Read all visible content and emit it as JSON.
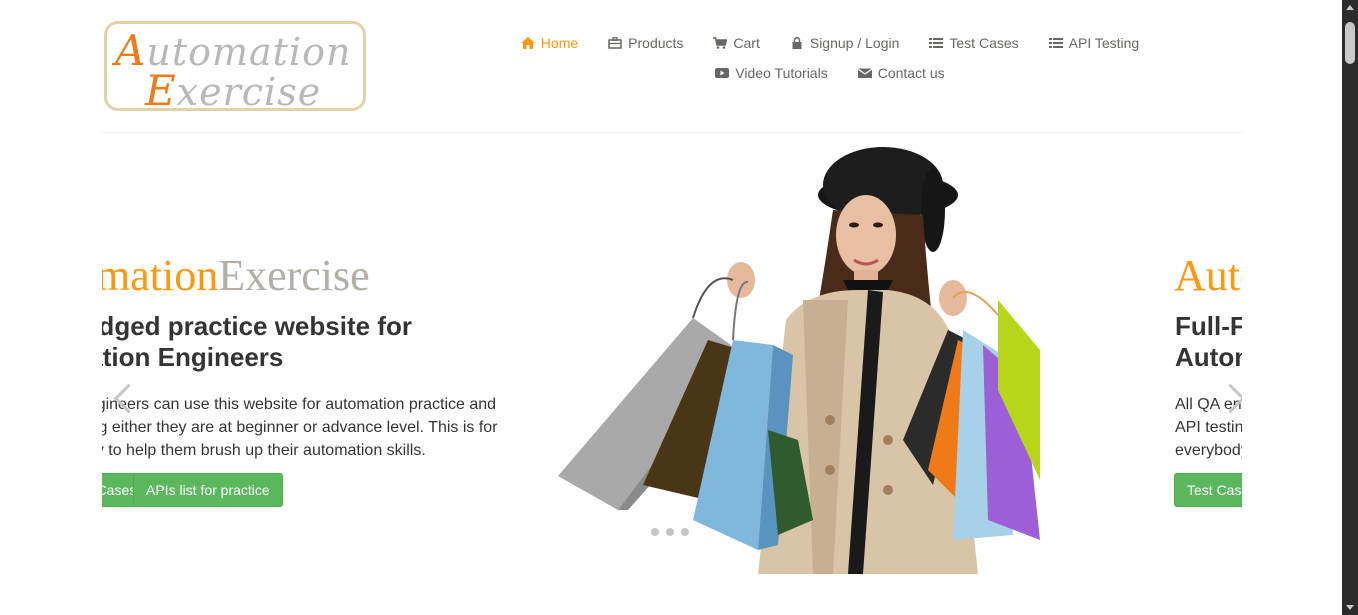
{
  "logo": {
    "line1_cap": "A",
    "line1_rest": "utomation",
    "line2_cap": "E",
    "line2_rest": "xercise",
    "colors": {
      "accent": "#f07a17",
      "text": "#b8b8b8",
      "border": "#e2d3a7"
    }
  },
  "nav": {
    "row1": [
      {
        "label": "Home",
        "icon": "home-icon",
        "active": true
      },
      {
        "label": "Products",
        "icon": "briefcase-icon"
      },
      {
        "label": "Cart",
        "icon": "cart-icon"
      },
      {
        "label": "Signup / Login",
        "icon": "lock-icon"
      },
      {
        "label": "Test Cases",
        "icon": "list-icon"
      },
      {
        "label": "API Testing",
        "icon": "list-icon"
      }
    ],
    "row2": [
      {
        "label": "Video Tutorials",
        "icon": "youtube-icon"
      },
      {
        "label": "Contact us",
        "icon": "envelope-icon"
      }
    ],
    "colors": {
      "active": "#fe980f",
      "default": "#696763"
    }
  },
  "slider": {
    "current": {
      "brand_a": "Automation",
      "brand_b": "Exercise",
      "headline_line1": "Full-Fledged practice website for",
      "headline_line2": "Automation Engineers",
      "desc_line1": "All QA engineers can use this website for automation practice and",
      "desc_line2": "API testing either they are at beginner or advance level. This is for",
      "desc_line3": "everybody to help them brush up their automation skills.",
      "button1": "Test Cases",
      "button2": "APIs list for practice"
    },
    "next": {
      "brand_a": "Automation",
      "headline_line1": "Full-Fledged practice website for",
      "headline_line2": "Automation Engineers",
      "desc_line1": "All QA engineers can use this website for automation practice and",
      "desc_line2": "API testing either they are at beginner or advance level. This is for",
      "desc_line3": "everybody to help them brush up their automation skills.",
      "button1": "Test Cases"
    },
    "dot_count": 3,
    "colors": {
      "brand_a": "#fe980f",
      "brand_b": "#b3afa8",
      "button": "#5cb85c"
    }
  }
}
